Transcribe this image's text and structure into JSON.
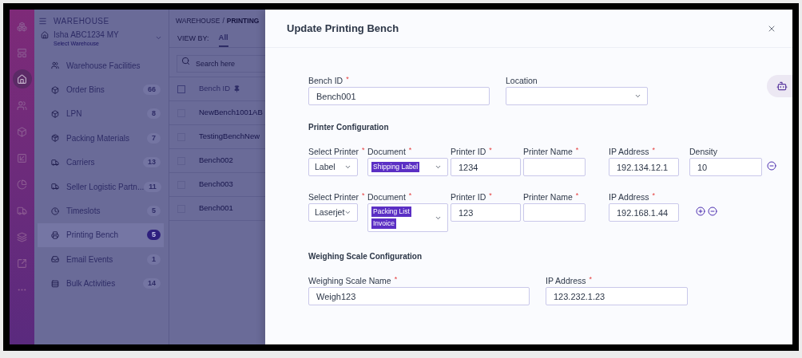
{
  "rail": [
    {
      "kind": "logo",
      "selected": false
    },
    {
      "kind": "dashboard",
      "selected": false
    },
    {
      "kind": "warehouse",
      "selected": true
    },
    {
      "kind": "users",
      "selected": false
    },
    {
      "kind": "box",
      "selected": false
    },
    {
      "kind": "inbound",
      "selected": false
    },
    {
      "kind": "reports",
      "selected": false
    },
    {
      "kind": "truck",
      "selected": false
    },
    {
      "kind": "layers",
      "selected": false
    },
    {
      "kind": "export",
      "selected": false
    },
    {
      "kind": "more",
      "selected": false
    }
  ],
  "sidebar": {
    "title": "WAREHOUSE",
    "warehouse": {
      "name": "Isha ABC1234 MY",
      "hint": "Select Warehouse"
    },
    "items": [
      {
        "kind": "facilities",
        "label": "Warehouse Facilities",
        "selected": false
      },
      {
        "kind": "box",
        "label": "Order Bins",
        "count": "66",
        "selected": false
      },
      {
        "kind": "box",
        "label": "LPN",
        "count": "8",
        "selected": false
      },
      {
        "kind": "package",
        "label": "Packing Materials",
        "count": "7",
        "selected": false
      },
      {
        "kind": "truck",
        "label": "Carriers",
        "count": "13",
        "selected": false
      },
      {
        "kind": "truck",
        "label": "Seller Logistic Partn...",
        "count": "11",
        "selected": false
      },
      {
        "kind": "clock",
        "label": "Timeslots",
        "count": "5",
        "selected": false
      },
      {
        "kind": "printer",
        "label": "Printing Bench",
        "count": "5",
        "selected": true
      },
      {
        "kind": "mail",
        "label": "Email Events",
        "count": "1",
        "selected": false
      },
      {
        "kind": "list",
        "label": "Bulk Activities",
        "count": "14",
        "selected": false
      }
    ]
  },
  "breadcrumb": {
    "items": [
      "WAREHOUSE",
      "PRINTING"
    ],
    "separator": "/"
  },
  "view_by": {
    "label": "VIEW BY:",
    "tabs": [
      {
        "label": "All",
        "selected": true
      }
    ]
  },
  "search": {
    "placeholder": "Search here"
  },
  "table": {
    "column": "Bench ID",
    "header_checked": false,
    "rows": [
      {
        "cell": "NewBench1001AB",
        "checked": false
      },
      {
        "cell": "TestingBenchNew",
        "checked": false
      },
      {
        "cell": "Bench002",
        "checked": false
      },
      {
        "cell": "Bench003",
        "checked": false
      },
      {
        "cell": "Bench001",
        "checked": false
      }
    ]
  },
  "modal": {
    "title": "Update Printing Bench",
    "required_mark": "*",
    "bench_id": {
      "label": "Bench ID",
      "required": true,
      "value": "Bench001"
    },
    "location": {
      "label": "Location",
      "required": false
    },
    "printer_section": "Printer Configuration",
    "printers": [
      {
        "select_printer": {
          "label": "Select Printer",
          "required": true,
          "value": "Label"
        },
        "document": {
          "label": "Document",
          "required": true,
          "tags": [
            "Shipping Label"
          ]
        },
        "printer_id": {
          "label": "Printer ID",
          "required": true,
          "value": "1234"
        },
        "printer_name": {
          "label": "Printer Name",
          "required": true
        },
        "ip_address": {
          "label": "IP Address",
          "required": true,
          "value": "192.134.12.1"
        },
        "density": {
          "label": "Density",
          "required": false,
          "value": "10"
        },
        "actions": [
          {
            "kind": "remove"
          }
        ]
      },
      {
        "select_printer": {
          "label": "Select Printer",
          "required": true,
          "value": "Laserjet"
        },
        "document": {
          "label": "Document",
          "required": true,
          "tags": [
            "Packing List",
            "Invoice"
          ]
        },
        "printer_id": {
          "label": "Printer ID",
          "required": true,
          "value": "123"
        },
        "printer_name": {
          "label": "Printer Name",
          "required": true
        },
        "ip_address": {
          "label": "IP Address",
          "required": true,
          "value": "192.168.1.44"
        },
        "actions": [
          {
            "kind": "add"
          },
          {
            "kind": "remove"
          }
        ]
      }
    ],
    "weighing_section": "Weighing Scale Configuration",
    "scale_name": {
      "label": "Weighing Scale Name",
      "required": true,
      "value": "Weigh123"
    },
    "scale_ip": {
      "label": "IP Address",
      "required": true,
      "value": "123.232.1.23"
    }
  }
}
